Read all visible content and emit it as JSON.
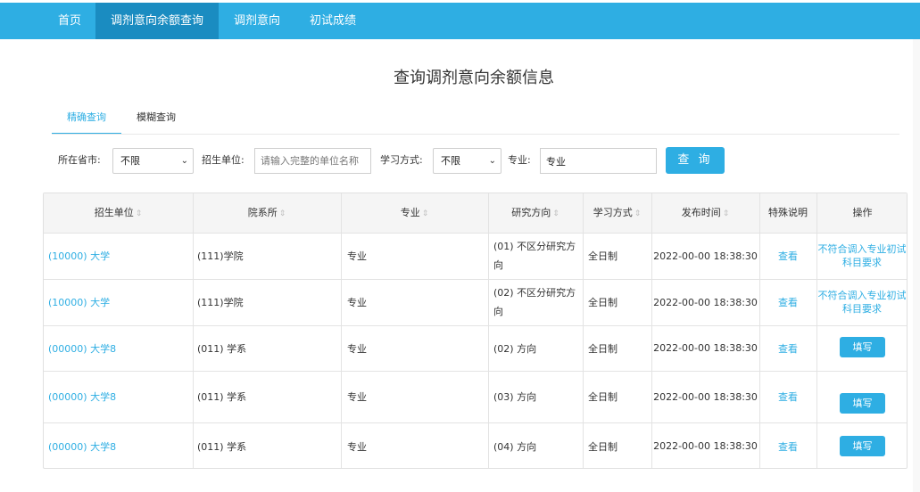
{
  "nav": {
    "home": "首页",
    "balance_query": "调剂意向余额查询",
    "intention": "调剂意向",
    "scores": "初试成绩"
  },
  "page_title": "查询调剂意向余额信息",
  "tabs": {
    "precise": "精确查询",
    "fuzzy": "模糊查询"
  },
  "filters": {
    "province_label": "所在省市:",
    "province_value": "不限",
    "unit_label": "招生单位:",
    "unit_placeholder": "请输入完整的单位名称",
    "mode_label": "学习方式:",
    "mode_value": "不限",
    "major_label": "专业:",
    "major_value": "专业",
    "query_button": "查 询"
  },
  "table": {
    "headers": {
      "unit": "招生单位",
      "dept": "院系所",
      "major": "专业",
      "direction": "研究方向",
      "mode": "学习方式",
      "time": "发布时间",
      "special": "特殊说明",
      "action": "操作"
    },
    "sort_icon": "⇕",
    "rows": [
      {
        "unit": "(10000) 大学",
        "dept": "(111)学院",
        "major": "专业",
        "direction": "(01) 不区分研究方向",
        "mode": "全日制",
        "time": "2022-00-00 18:38:30",
        "special": "查看",
        "action_note": "不符合调入专业初试科目要求"
      },
      {
        "unit": "(10000) 大学",
        "dept": "(111)学院",
        "major": "专业",
        "direction": "(02) 不区分研究方向",
        "mode": "全日制",
        "time": "2022-00-00 18:38:30",
        "special": "查看",
        "action_note": "不符合调入专业初试科目要求"
      },
      {
        "unit": "(00000) 大学8",
        "dept": "(011) 学系",
        "major": "专业",
        "direction": "(02) 方向",
        "mode": "全日制",
        "time": "2022-00-00 18:38:30",
        "special": "查看",
        "action_button": "填写"
      },
      {
        "unit": "(00000) 大学8",
        "dept": "(011) 学系",
        "major": "专业",
        "direction": "(03) 方向",
        "mode": "全日制",
        "time": "2022-00-00 18:38:30",
        "special": "查看",
        "action_button": "填写"
      },
      {
        "unit": "(00000) 大学8",
        "dept": "(011) 学系",
        "major": "专业",
        "direction": "(04) 方向",
        "mode": "全日制",
        "time": "2022-00-00 18:38:30",
        "special": "查看",
        "action_button": "填写"
      }
    ]
  },
  "colors": {
    "accent": "#2eaee3",
    "nav_active": "#1a8cc1"
  }
}
